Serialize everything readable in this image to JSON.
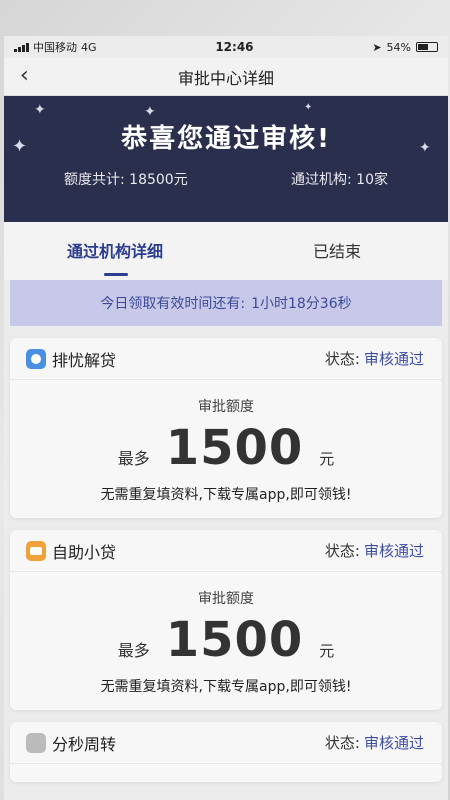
{
  "status_bar": {
    "carrier": "中国移动",
    "network": "4G",
    "time": "12:46",
    "battery": "54%",
    "icons": [
      "signal-icon",
      "location-icon",
      "battery-icon"
    ]
  },
  "nav": {
    "back_icon": "‹",
    "title": "审批中心详细"
  },
  "banner": {
    "title": "恭喜您通过审核!",
    "total_label": "额度共计:",
    "total_value": "18500元",
    "orgs_label": "通过机构:",
    "orgs_value": "10家"
  },
  "tabs": [
    {
      "label": "通过机构详细",
      "active": true
    },
    {
      "label": "已结束",
      "active": false
    }
  ],
  "countdown": {
    "label": "今日领取有效时间还有:",
    "time": "1小时18分36秒"
  },
  "cards": [
    {
      "name": "排忧解贷",
      "status_label": "状态:",
      "status_value": "审核通过",
      "amount_label": "审批额度",
      "amount_prefix": "最多",
      "amount": "1500",
      "unit": "元",
      "note": "无需重复填资料,下载专属app,即可领钱!"
    },
    {
      "name": "自助小贷",
      "status_label": "状态:",
      "status_value": "审核通过",
      "amount_label": "审批额度",
      "amount_prefix": "最多",
      "amount": "1500",
      "unit": "元",
      "note": "无需重复填资料,下载专属app,即可领钱!"
    },
    {
      "name": "分秒周转",
      "status_label": "状态:",
      "status_value": "审核通过"
    }
  ],
  "colors": {
    "banner_bg": "#2a2f4d",
    "accent": "#3b4fa3",
    "countdown_bg": "#c8c9e8"
  }
}
